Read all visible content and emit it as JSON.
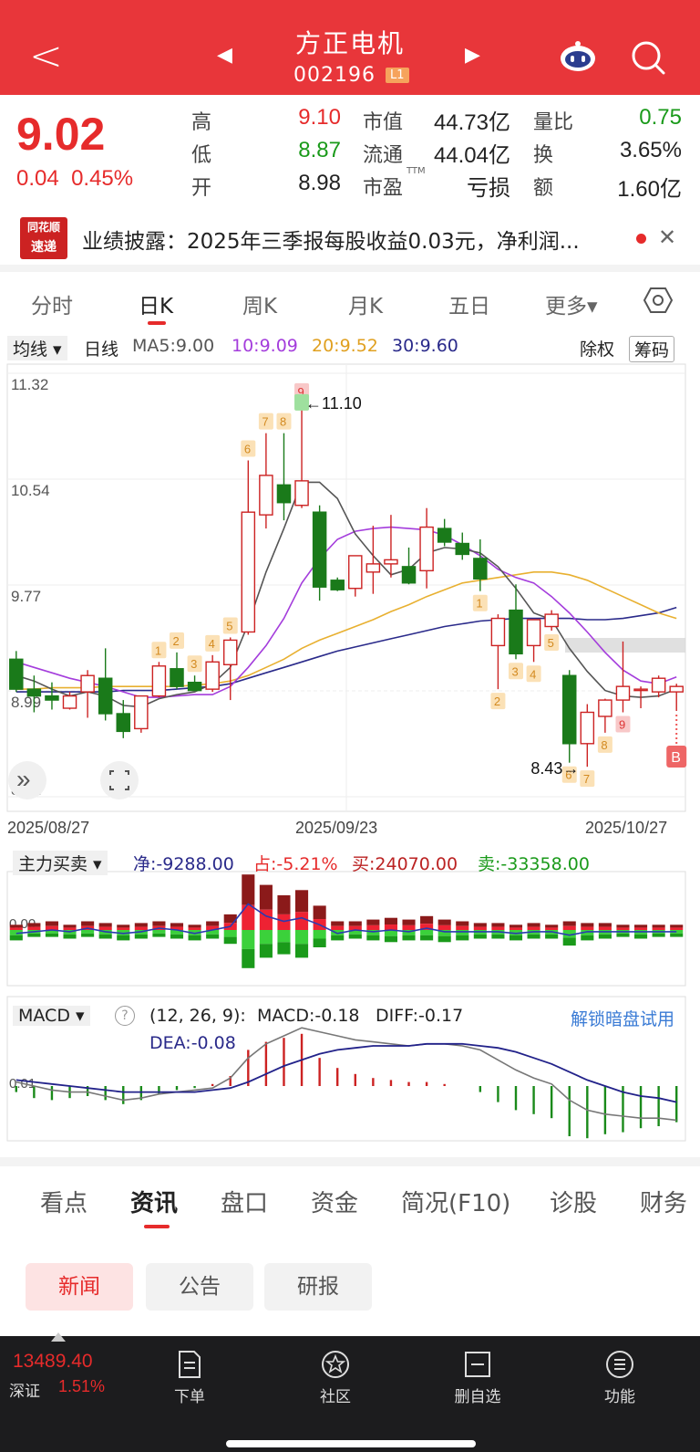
{
  "header": {
    "back": "<",
    "title": "方正电机",
    "code": "002196",
    "level": "L1",
    "prev": "◀",
    "next": "▶"
  },
  "quote": {
    "price": "9.02",
    "change": "0.04",
    "change_pct": "0.45%",
    "rows": [
      {
        "l1": "高",
        "v1": "9.10",
        "l2": "市值",
        "v2": "44.73亿",
        "l3": "量比",
        "v3": "0.75"
      },
      {
        "l1": "低",
        "v1": "8.87",
        "l2": "流通",
        "v2": "44.04亿",
        "l3": "换",
        "v3": "3.65%"
      },
      {
        "l1": "开",
        "v1": "8.98",
        "l2": "市盈",
        "l2_sup": "TTM",
        "v2": "亏损",
        "l3": "额",
        "v3": "1.60亿"
      }
    ]
  },
  "news": {
    "logo_line1": "同花顺",
    "logo_line2": "速递",
    "text": "业绩披露：2025年三季报每股收益0.03元，净利润...",
    "close": "✕"
  },
  "ktabs": [
    "分时",
    "日K",
    "周K",
    "月K",
    "五日",
    "更多▾"
  ],
  "ma_row": {
    "mode": "均线 ▾",
    "period": "日线",
    "ma5": "MA5:9.00",
    "ma10": "10:9.09",
    "ma20": "20:9.52",
    "ma30": "30:9.60",
    "adjust": "除权",
    "chips": "筹码"
  },
  "colors": {
    "up": "#e62b2b",
    "down": "#1a8a1a",
    "ma5": "#555555",
    "ma10": "#a43ddc",
    "ma20": "#e8b030",
    "ma30": "#2a2a8a",
    "brand": "#e8363a"
  },
  "chart_data": [
    {
      "type": "candlestick",
      "y_ticks": [
        "11.32",
        "10.54",
        "9.77",
        "8.99",
        "8.21"
      ],
      "ylim": [
        8.21,
        11.32
      ],
      "x_ticks": [
        "2025/08/27",
        "2025/09/23",
        "2025/10/27"
      ],
      "high_marker": "←11.10",
      "low_marker": "8.43→",
      "candles": [
        {
          "o": 9.22,
          "h": 9.28,
          "l": 8.98,
          "c": 9.0
        },
        {
          "o": 9.0,
          "h": 9.1,
          "l": 8.83,
          "c": 8.95
        },
        {
          "o": 8.95,
          "h": 9.05,
          "l": 8.85,
          "c": 8.92
        },
        {
          "o": 8.86,
          "h": 8.98,
          "l": 8.85,
          "c": 8.95
        },
        {
          "o": 8.98,
          "h": 9.14,
          "l": 8.79,
          "c": 9.1
        },
        {
          "o": 9.08,
          "h": 9.3,
          "l": 8.77,
          "c": 8.82
        },
        {
          "o": 8.82,
          "h": 8.92,
          "l": 8.64,
          "c": 8.69
        },
        {
          "o": 8.71,
          "h": 8.95,
          "l": 8.68,
          "c": 8.95
        },
        {
          "o": 8.95,
          "h": 9.2,
          "l": 8.94,
          "c": 9.17
        },
        {
          "o": 9.15,
          "h": 9.27,
          "l": 9.0,
          "c": 9.02
        },
        {
          "o": 9.05,
          "h": 9.1,
          "l": 8.99,
          "c": 8.99
        },
        {
          "o": 9.0,
          "h": 9.25,
          "l": 8.98,
          "c": 9.2
        },
        {
          "o": 9.18,
          "h": 9.38,
          "l": 8.92,
          "c": 9.36
        },
        {
          "o": 9.42,
          "h": 10.68,
          "l": 9.4,
          "c": 10.3
        },
        {
          "o": 10.28,
          "h": 10.88,
          "l": 10.18,
          "c": 10.57
        },
        {
          "o": 10.5,
          "h": 10.88,
          "l": 10.24,
          "c": 10.37
        },
        {
          "o": 10.35,
          "h": 11.1,
          "l": 10.33,
          "c": 10.53
        },
        {
          "o": 10.3,
          "h": 10.35,
          "l": 9.65,
          "c": 9.75
        },
        {
          "o": 9.8,
          "h": 9.82,
          "l": 9.72,
          "c": 9.73
        },
        {
          "o": 9.74,
          "h": 9.97,
          "l": 9.68,
          "c": 9.98
        },
        {
          "o": 9.86,
          "h": 10.2,
          "l": 9.7,
          "c": 9.92
        },
        {
          "o": 9.92,
          "h": 10.28,
          "l": 9.82,
          "c": 9.95
        },
        {
          "o": 9.9,
          "h": 10.04,
          "l": 9.77,
          "c": 9.78
        },
        {
          "o": 9.87,
          "h": 10.33,
          "l": 9.74,
          "c": 10.19
        },
        {
          "o": 10.18,
          "h": 10.25,
          "l": 10.05,
          "c": 10.08
        },
        {
          "o": 10.07,
          "h": 10.15,
          "l": 9.95,
          "c": 9.99
        },
        {
          "o": 9.96,
          "h": 10.1,
          "l": 9.72,
          "c": 9.81
        },
        {
          "o": 9.32,
          "h": 9.55,
          "l": 9.0,
          "c": 9.52
        },
        {
          "o": 9.58,
          "h": 9.77,
          "l": 9.22,
          "c": 9.26
        },
        {
          "o": 9.32,
          "h": 9.5,
          "l": 9.2,
          "c": 9.51
        },
        {
          "o": 9.46,
          "h": 9.58,
          "l": 9.43,
          "c": 9.55
        },
        {
          "o": 9.1,
          "h": 9.14,
          "l": 8.46,
          "c": 8.6
        },
        {
          "o": 8.6,
          "h": 8.89,
          "l": 8.43,
          "c": 8.83
        },
        {
          "o": 8.8,
          "h": 8.93,
          "l": 8.68,
          "c": 8.92
        },
        {
          "o": 8.92,
          "h": 9.35,
          "l": 8.83,
          "c": 9.02
        },
        {
          "o": 9.0,
          "h": 9.02,
          "l": 8.86,
          "c": 9.0
        },
        {
          "o": 8.98,
          "h": 9.1,
          "l": 8.94,
          "c": 9.08
        },
        {
          "o": 8.98,
          "h": 9.04,
          "l": 8.84,
          "c": 9.02
        }
      ],
      "ma5": [
        9.1,
        9.06,
        9.0,
        8.95,
        8.98,
        8.95,
        8.88,
        8.87,
        8.93,
        8.96,
        8.98,
        9.04,
        9.16,
        9.48,
        9.86,
        10.18,
        10.52,
        10.52,
        10.4,
        10.14,
        9.98,
        9.84,
        9.88,
        10.0,
        10.04,
        10.03,
        10.0,
        9.9,
        9.74,
        9.56,
        9.51,
        9.3,
        9.13,
        8.99,
        8.95,
        8.94,
        8.95,
        9.0
      ],
      "ma10": [
        9.2,
        9.16,
        9.12,
        9.08,
        9.05,
        9.02,
        8.98,
        8.94,
        8.94,
        8.95,
        8.96,
        8.96,
        9.02,
        9.16,
        9.32,
        9.52,
        9.78,
        9.96,
        10.1,
        10.16,
        10.18,
        10.19,
        10.18,
        10.17,
        10.13,
        10.06,
        9.98,
        9.88,
        9.82,
        9.78,
        9.68,
        9.56,
        9.42,
        9.27,
        9.14,
        9.06,
        9.04,
        9.09
      ],
      "ma20": [
        9.0,
        9.0,
        9.01,
        9.01,
        9.01,
        9.02,
        9.02,
        9.02,
        9.02,
        9.02,
        9.03,
        9.04,
        9.06,
        9.1,
        9.16,
        9.22,
        9.3,
        9.36,
        9.41,
        9.46,
        9.51,
        9.57,
        9.62,
        9.68,
        9.73,
        9.78,
        9.8,
        9.82,
        9.84,
        9.86,
        9.86,
        9.84,
        9.8,
        9.74,
        9.68,
        9.62,
        9.56,
        9.52
      ],
      "ma30": [
        8.98,
        8.98,
        8.98,
        8.98,
        8.98,
        8.98,
        8.99,
        8.99,
        8.99,
        9.0,
        9.01,
        9.02,
        9.04,
        9.08,
        9.12,
        9.16,
        9.2,
        9.24,
        9.28,
        9.31,
        9.34,
        9.37,
        9.4,
        9.43,
        9.46,
        9.48,
        9.5,
        9.51,
        9.52,
        9.52,
        9.52,
        9.52,
        9.51,
        9.51,
        9.52,
        9.54,
        9.56,
        9.6
      ],
      "signals": [
        {
          "i": 8,
          "label": "1",
          "pos": "above"
        },
        {
          "i": 9,
          "label": "2",
          "pos": "above"
        },
        {
          "i": 10,
          "label": "3",
          "pos": "above"
        },
        {
          "i": 11,
          "label": "4",
          "pos": "above"
        },
        {
          "i": 12,
          "label": "5",
          "pos": "above"
        },
        {
          "i": 13,
          "label": "6",
          "pos": "above"
        },
        {
          "i": 14,
          "label": "7",
          "pos": "above"
        },
        {
          "i": 15,
          "label": "8",
          "pos": "above"
        },
        {
          "i": 16,
          "label": "9",
          "pos": "above"
        },
        {
          "i": 26,
          "label": "1",
          "pos": "below"
        },
        {
          "i": 27,
          "label": "2",
          "pos": "below"
        },
        {
          "i": 28,
          "label": "3",
          "pos": "below"
        },
        {
          "i": 29,
          "label": "4",
          "pos": "below"
        },
        {
          "i": 30,
          "label": "5",
          "pos": "below"
        },
        {
          "i": 31,
          "label": "6",
          "pos": "below"
        },
        {
          "i": 32,
          "label": "7",
          "pos": "below"
        },
        {
          "i": 33,
          "label": "8",
          "pos": "below"
        },
        {
          "i": 34,
          "label": "9",
          "pos": "below"
        }
      ],
      "buy_marker": "B"
    },
    {
      "type": "bar",
      "title": "主力买卖 ▾",
      "net": "净:-9288.00",
      "share": "占:-5.21%",
      "buy": "买:24070.00",
      "sell": "卖:-33358.00",
      "zero_label": "0.00",
      "buy_values": [
        3,
        4,
        5,
        3,
        5,
        4,
        3,
        4,
        5,
        4,
        3,
        5,
        9,
        32,
        26,
        20,
        23,
        14,
        5,
        5,
        6,
        7,
        6,
        8,
        6,
        5,
        4,
        4,
        3,
        4,
        3,
        5,
        4,
        4,
        3,
        3,
        3,
        3
      ],
      "sell_values": [
        -6,
        -4,
        -4,
        -5,
        -4,
        -5,
        -6,
        -5,
        -4,
        -5,
        -6,
        -5,
        -8,
        -22,
        -16,
        -14,
        -16,
        -10,
        -6,
        -5,
        -6,
        -7,
        -6,
        -6,
        -7,
        -6,
        -5,
        -5,
        -6,
        -5,
        -5,
        -9,
        -6,
        -5,
        -4,
        -5,
        -4,
        -4
      ],
      "net_line": [
        -2,
        -1,
        0,
        -1,
        1,
        -1,
        -2,
        -1,
        1,
        0,
        -2,
        0,
        2,
        15,
        8,
        5,
        7,
        3,
        -2,
        0,
        -1,
        0,
        -1,
        1,
        -1,
        -1,
        -1,
        -1,
        -2,
        -1,
        -1,
        -3,
        -1,
        -1,
        -1,
        -1,
        -1,
        -1
      ]
    },
    {
      "type": "bar",
      "title": "MACD ▾",
      "params": "(12, 26, 9):",
      "macd_label": "MACD:-0.18",
      "diff_label": "DIFF:-0.17",
      "dea_label": "DEA:-0.08",
      "unlock": "解锁暗盘试用",
      "zero_label": "0.01",
      "macd": [
        -0.03,
        -0.06,
        -0.07,
        -0.06,
        -0.05,
        -0.07,
        -0.09,
        -0.07,
        -0.04,
        -0.02,
        -0.01,
        0.01,
        0.05,
        0.18,
        0.22,
        0.24,
        0.26,
        0.14,
        0.09,
        0.06,
        0.04,
        0.03,
        0.02,
        0.02,
        0.01,
        0.0,
        -0.03,
        -0.08,
        -0.12,
        -0.14,
        -0.16,
        -0.25,
        -0.26,
        -0.24,
        -0.23,
        -0.21,
        -0.2,
        -0.18
      ],
      "diff": [
        0.02,
        0.0,
        -0.02,
        -0.03,
        -0.03,
        -0.05,
        -0.07,
        -0.06,
        -0.04,
        -0.03,
        -0.02,
        -0.01,
        0.04,
        0.14,
        0.21,
        0.25,
        0.29,
        0.27,
        0.25,
        0.23,
        0.22,
        0.21,
        0.2,
        0.21,
        0.21,
        0.2,
        0.18,
        0.13,
        0.08,
        0.04,
        0.01,
        -0.07,
        -0.12,
        -0.14,
        -0.15,
        -0.16,
        -0.16,
        -0.17
      ],
      "dea": [
        0.03,
        0.02,
        0.01,
        0.0,
        -0.01,
        -0.02,
        -0.03,
        -0.03,
        -0.03,
        -0.03,
        -0.03,
        -0.02,
        -0.01,
        0.02,
        0.06,
        0.1,
        0.13,
        0.16,
        0.18,
        0.19,
        0.2,
        0.2,
        0.2,
        0.21,
        0.21,
        0.21,
        0.2,
        0.19,
        0.17,
        0.14,
        0.11,
        0.07,
        0.03,
        0.0,
        -0.03,
        -0.05,
        -0.06,
        -0.08
      ]
    }
  ],
  "info_tabs": [
    "看点",
    "资讯",
    "盘口",
    "资金",
    "简况(F10)",
    "诊股",
    "财务"
  ],
  "sub_tabs": [
    "新闻",
    "公告",
    "研报"
  ],
  "bottom_nav": {
    "index_value": "13489.40",
    "index_name": "深证",
    "index_pct": "1.51%",
    "items": [
      {
        "icon": "order-icon",
        "label": "下单"
      },
      {
        "icon": "community-icon",
        "label": "社区"
      },
      {
        "icon": "remove-watchlist-icon",
        "label": "删自选"
      },
      {
        "icon": "menu-icon",
        "label": "功能"
      }
    ]
  }
}
